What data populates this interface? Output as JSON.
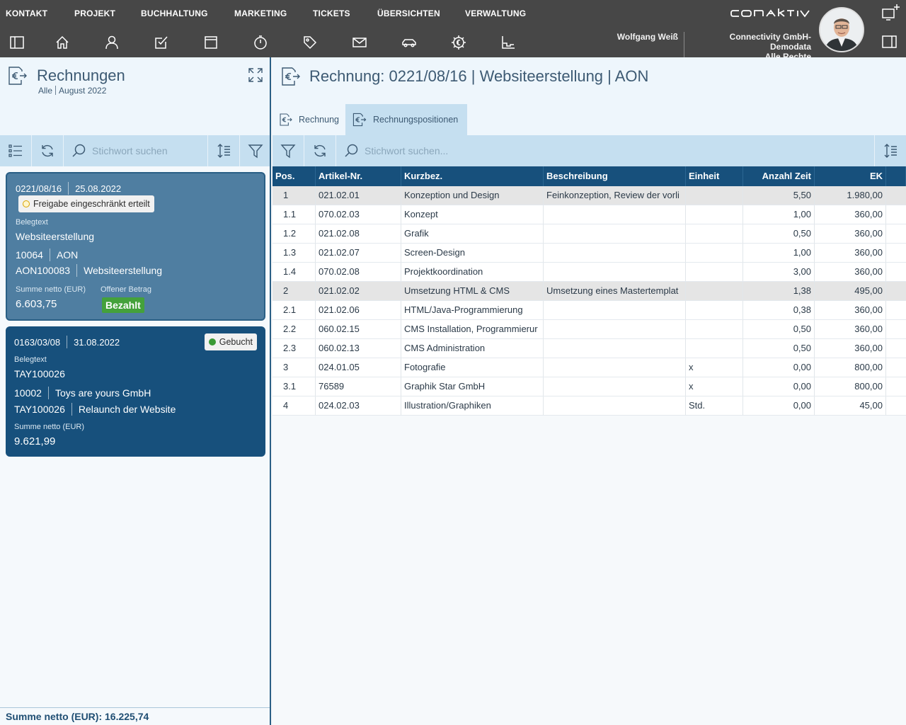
{
  "menu": [
    "KONTAKT",
    "PROJEKT",
    "BUCHHALTUNG",
    "MARKETING",
    "TICKETS",
    "ÜBERSICHTEN",
    "VERWALTUNG"
  ],
  "toolbar_icons": [
    "sidebar-toggle-icon",
    "home-icon",
    "contact-icon",
    "tasks-icon",
    "calendar-icon",
    "timer-icon",
    "tag-icon",
    "mail-icon",
    "car-icon",
    "euro-settings-icon",
    "chart-icon"
  ],
  "brand": {
    "logo": "conaktiv"
  },
  "user": {
    "name": "Wolfgang Weiß",
    "company": "Connectivity GmbH-Demodata",
    "rights": "Alle Rechte"
  },
  "left": {
    "title": "Rechnungen",
    "filter": "Alle",
    "period": "August 2022",
    "search_placeholder": "Stichwort suchen",
    "cards": [
      {
        "number": "0221/08/16",
        "date": "25.08.2022",
        "status": "Freigabe eingeschränkt erteilt",
        "belegtext_label": "Belegtext",
        "belegtext": "Websiteerstellung",
        "customer_no": "10064",
        "customer": "AON",
        "project_no": "AON100083",
        "project": "Websiteerstellung",
        "sum_label": "Summe netto (EUR)",
        "sum": "6.603,75",
        "open_label": "Offener Betrag",
        "open_status": "Bezahlt"
      },
      {
        "number": "0163/03/08",
        "date": "31.08.2022",
        "status": "Gebucht",
        "belegtext_label": "Belegtext",
        "belegtext": "TAY100026",
        "customer_no": "10002",
        "customer": "Toys are yours GmbH",
        "project_no": "TAY100026",
        "project": "Relaunch der Website",
        "sum_label": "Summe netto (EUR)",
        "sum": "9.621,99"
      }
    ],
    "footer": "Summe netto (EUR): 16.225,74"
  },
  "right": {
    "title": "Rechnung: 0221/08/16 | Websiteerstellung | AON",
    "tabs": [
      "Rechnung",
      "Rechnungspositionen"
    ],
    "search_placeholder": "Stichwort suchen...",
    "columns": [
      "Pos.",
      "Artikel-Nr.",
      "Kurzbez.",
      "Beschreibung",
      "Einheit",
      "Anzahl Zeit",
      "EK"
    ],
    "rows": [
      {
        "pos": "1",
        "art": "021.02.01",
        "kurz": "Konzeption und Design",
        "beschr": "Feinkonzeption, Review der vorli",
        "einheit": "",
        "anzahl": "5,50",
        "ek": "1.980,00",
        "group": true
      },
      {
        "pos": "1.1",
        "art": "070.02.03",
        "kurz": "Konzept",
        "beschr": "",
        "einheit": "",
        "anzahl": "1,00",
        "ek": "360,00"
      },
      {
        "pos": "1.2",
        "art": "021.02.08",
        "kurz": "Grafik",
        "beschr": "",
        "einheit": "",
        "anzahl": "0,50",
        "ek": "360,00"
      },
      {
        "pos": "1.3",
        "art": "021.02.07",
        "kurz": "Screen-Design",
        "beschr": "",
        "einheit": "",
        "anzahl": "1,00",
        "ek": "360,00"
      },
      {
        "pos": "1.4",
        "art": "070.02.08",
        "kurz": "Projektkoordination",
        "beschr": "",
        "einheit": "",
        "anzahl": "3,00",
        "ek": "360,00"
      },
      {
        "pos": "2",
        "art": "021.02.02",
        "kurz": "Umsetzung HTML & CMS",
        "beschr": "Umsetzung eines Mastertemplat",
        "einheit": "",
        "anzahl": "1,38",
        "ek": "495,00",
        "group": true
      },
      {
        "pos": "2.1",
        "art": "021.02.06",
        "kurz": "HTML/Java-Programmierung",
        "beschr": "",
        "einheit": "",
        "anzahl": "0,38",
        "ek": "360,00"
      },
      {
        "pos": "2.2",
        "art": "060.02.15",
        "kurz": "CMS Installation, Programmierur",
        "beschr": "",
        "einheit": "",
        "anzahl": "0,50",
        "ek": "360,00"
      },
      {
        "pos": "2.3",
        "art": "060.02.13",
        "kurz": "CMS Administration",
        "beschr": "",
        "einheit": "",
        "anzahl": "0,50",
        "ek": "360,00"
      },
      {
        "pos": "3",
        "art": "024.01.05",
        "kurz": "Fotografie",
        "beschr": "",
        "einheit": "x",
        "anzahl": "0,00",
        "ek": "800,00"
      },
      {
        "pos": "3.1",
        "art": "76589",
        "kurz": "Graphik Star GmbH",
        "beschr": "",
        "einheit": "x",
        "anzahl": "0,00",
        "ek": "800,00"
      },
      {
        "pos": "4",
        "art": "024.02.03",
        "kurz": "Illustration/Graphiken",
        "beschr": "",
        "einheit": "Std.",
        "anzahl": "0,00",
        "ek": "45,00"
      }
    ]
  },
  "colors": {
    "topbar": "#474747",
    "accent": "#17507c",
    "toolbar": "#c5dff0",
    "paid": "#44a13b",
    "booked": "#3a9a36",
    "pending": "#e0b000"
  }
}
